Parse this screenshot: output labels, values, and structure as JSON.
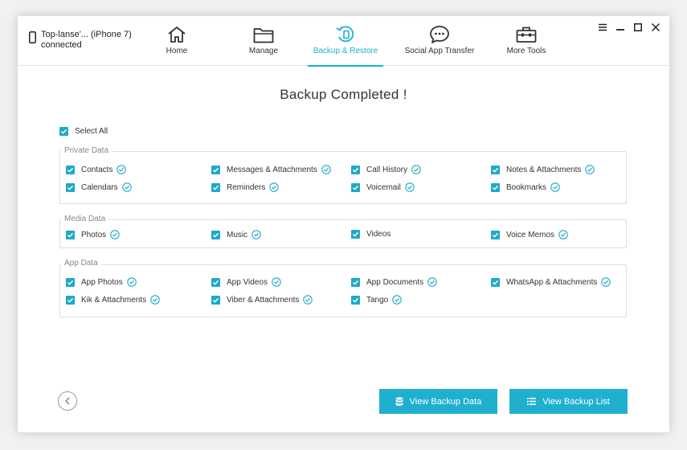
{
  "device": {
    "name": "Top-lanse'... (iPhone 7)",
    "status": "connected"
  },
  "nav": [
    {
      "label": "Home",
      "icon": "home-icon"
    },
    {
      "label": "Manage",
      "icon": "folder-icon"
    },
    {
      "label": "Backup & Restore",
      "icon": "backup-restore-icon"
    },
    {
      "label": "Social App Transfer",
      "icon": "chat-bubble-icon"
    },
    {
      "label": "More Tools",
      "icon": "toolbox-icon"
    }
  ],
  "active_nav": "Backup & Restore",
  "title": "Backup Completed !",
  "select_all": "Select All",
  "groups": {
    "private": {
      "title": "Private Data",
      "items": [
        "Contacts",
        "Messages & Attachments",
        "Call History",
        "Notes & Attachments",
        "Calendars",
        "Reminders",
        "Voicemail",
        "Bookmarks"
      ]
    },
    "media": {
      "title": "Media Data",
      "items": [
        "Photos",
        "Music",
        "Videos",
        "Voice Memos"
      ]
    },
    "app": {
      "title": "App Data",
      "items": [
        "App Photos",
        "App Videos",
        "App Documents",
        "WhatsApp & Attachments",
        "Kik & Attachments",
        "Viber & Attachments",
        "Tango"
      ]
    }
  },
  "buttons": {
    "view_backup_data": "View Backup Data",
    "view_backup_list": "View Backup List"
  },
  "colors": {
    "accent": "#1fb0cf",
    "checkbox": "#1fa9c8"
  }
}
